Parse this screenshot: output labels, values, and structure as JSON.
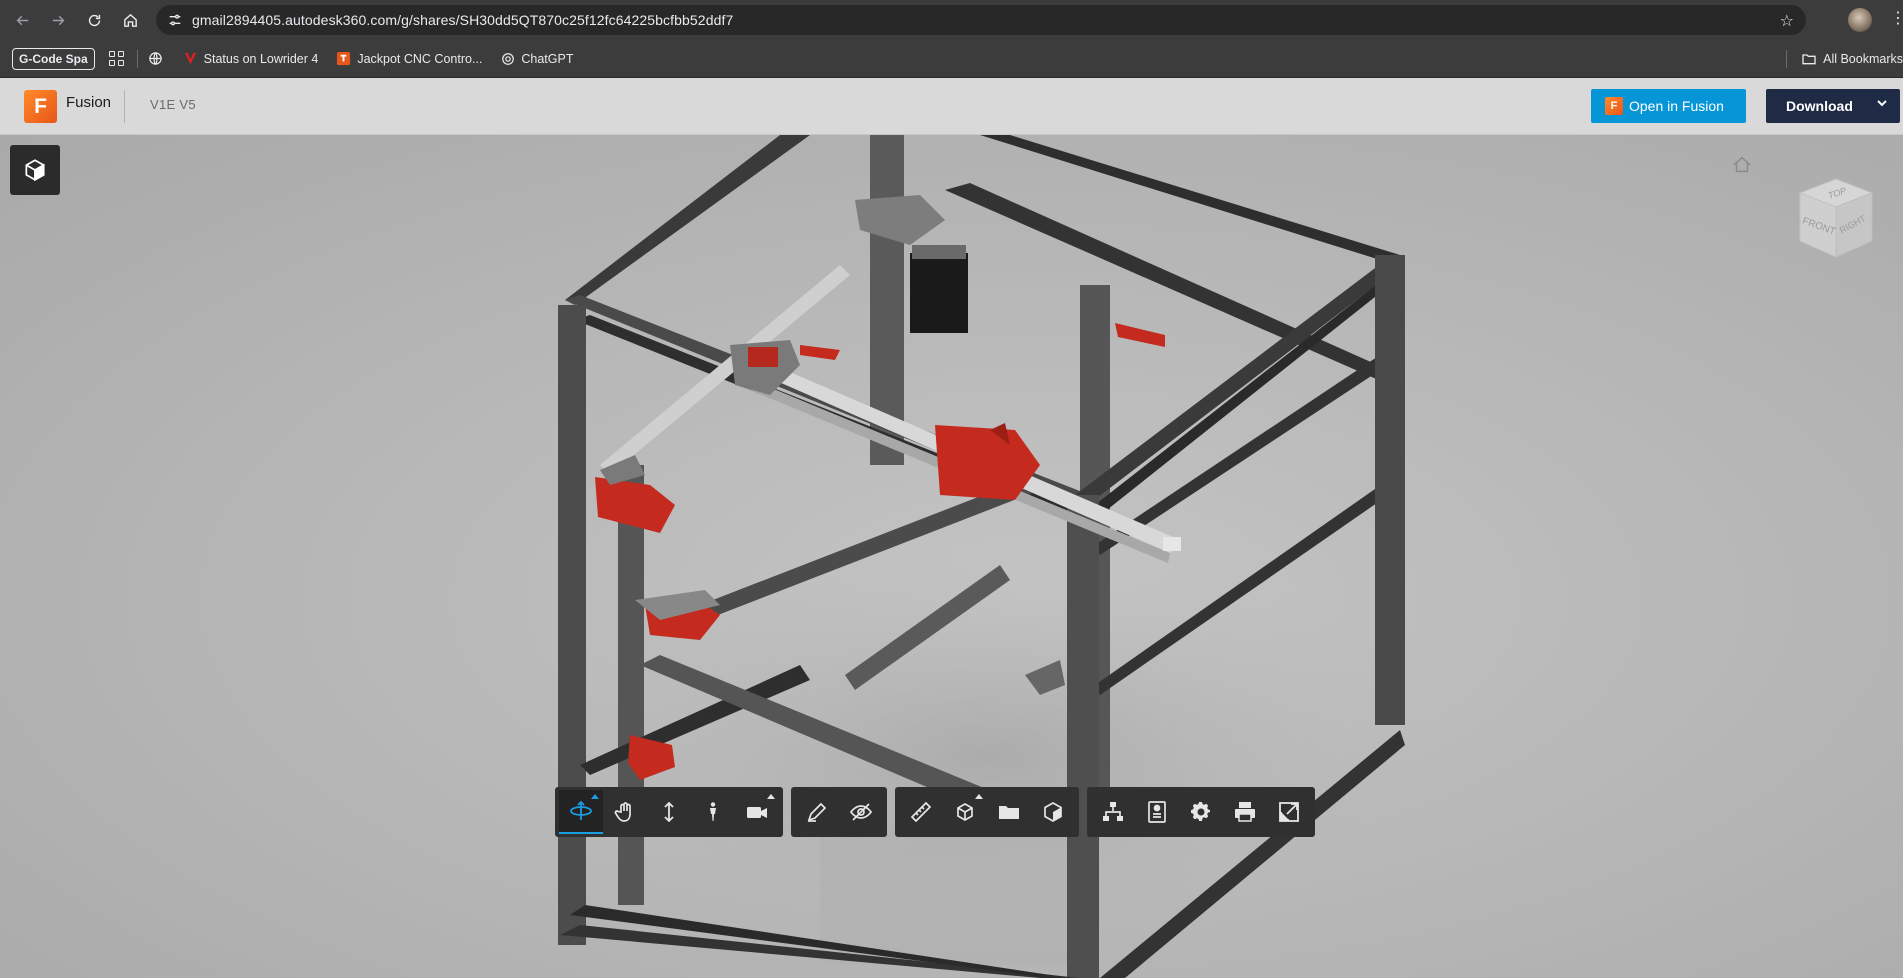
{
  "browser": {
    "url": "gmail2894405.autodesk360.com/g/shares/SH30dd5QT870c25f12fc64225bcfbb52ddf7",
    "bookmarks": {
      "chip": "G-Code Spa",
      "items": [
        {
          "label": "Status on Lowrider 4",
          "icon": "v1-logo-icon"
        },
        {
          "label": "Jackpot CNC Contro...",
          "icon": "jackpot-icon"
        },
        {
          "label": "ChatGPT",
          "icon": "chatgpt-icon"
        }
      ],
      "all_bookmarks": "All Bookmarks"
    }
  },
  "app": {
    "logo_letter": "F",
    "name": "Fusion",
    "document": "V1E V5",
    "open_button": "Open in Fusion",
    "open_button_logo": "F",
    "download_button": "Download"
  },
  "viewcube": {
    "top": "TOP",
    "front": "FRONT",
    "right": "RIGHT"
  },
  "toolbar": {
    "groups": [
      [
        "orbit-icon",
        "pan-icon",
        "zoom-icon",
        "first-person-icon",
        "camera-icon"
      ],
      [
        "markup-icon",
        "visibility-icon"
      ],
      [
        "measure-icon",
        "explode-icon",
        "folder-icon",
        "section-icon"
      ],
      [
        "model-browser-icon",
        "properties-icon",
        "settings-icon",
        "print-icon",
        "fullscreen-icon"
      ]
    ]
  },
  "colors": {
    "accent": "#0696d7",
    "download": "#1f2a44",
    "fusion_orange": "#e8561a",
    "part_red": "#c42a1e"
  }
}
